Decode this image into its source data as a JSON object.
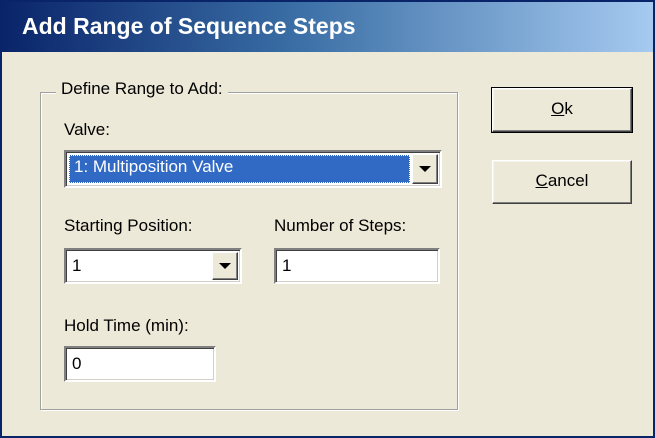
{
  "window": {
    "title": "Add Range of Sequence Steps"
  },
  "group": {
    "legend": "Define Range to Add:",
    "valve_label": "Valve:",
    "valve_selected": "1: Multiposition Valve",
    "start_label": "Starting Position:",
    "start_value": "1",
    "steps_label": "Number of Steps:",
    "steps_value": "1",
    "hold_label": "Hold Time (min):",
    "hold_value": "0"
  },
  "buttons": {
    "ok_mnemonic": "O",
    "ok_rest": "k",
    "cancel_mnemonic": "C",
    "cancel_rest": "ancel"
  },
  "icons": {
    "dropdown": "chevron-down-icon"
  },
  "colors": {
    "face": "#ece9d8",
    "title_start": "#0a246a",
    "title_end": "#a6caf0",
    "selection": "#316ac5"
  }
}
